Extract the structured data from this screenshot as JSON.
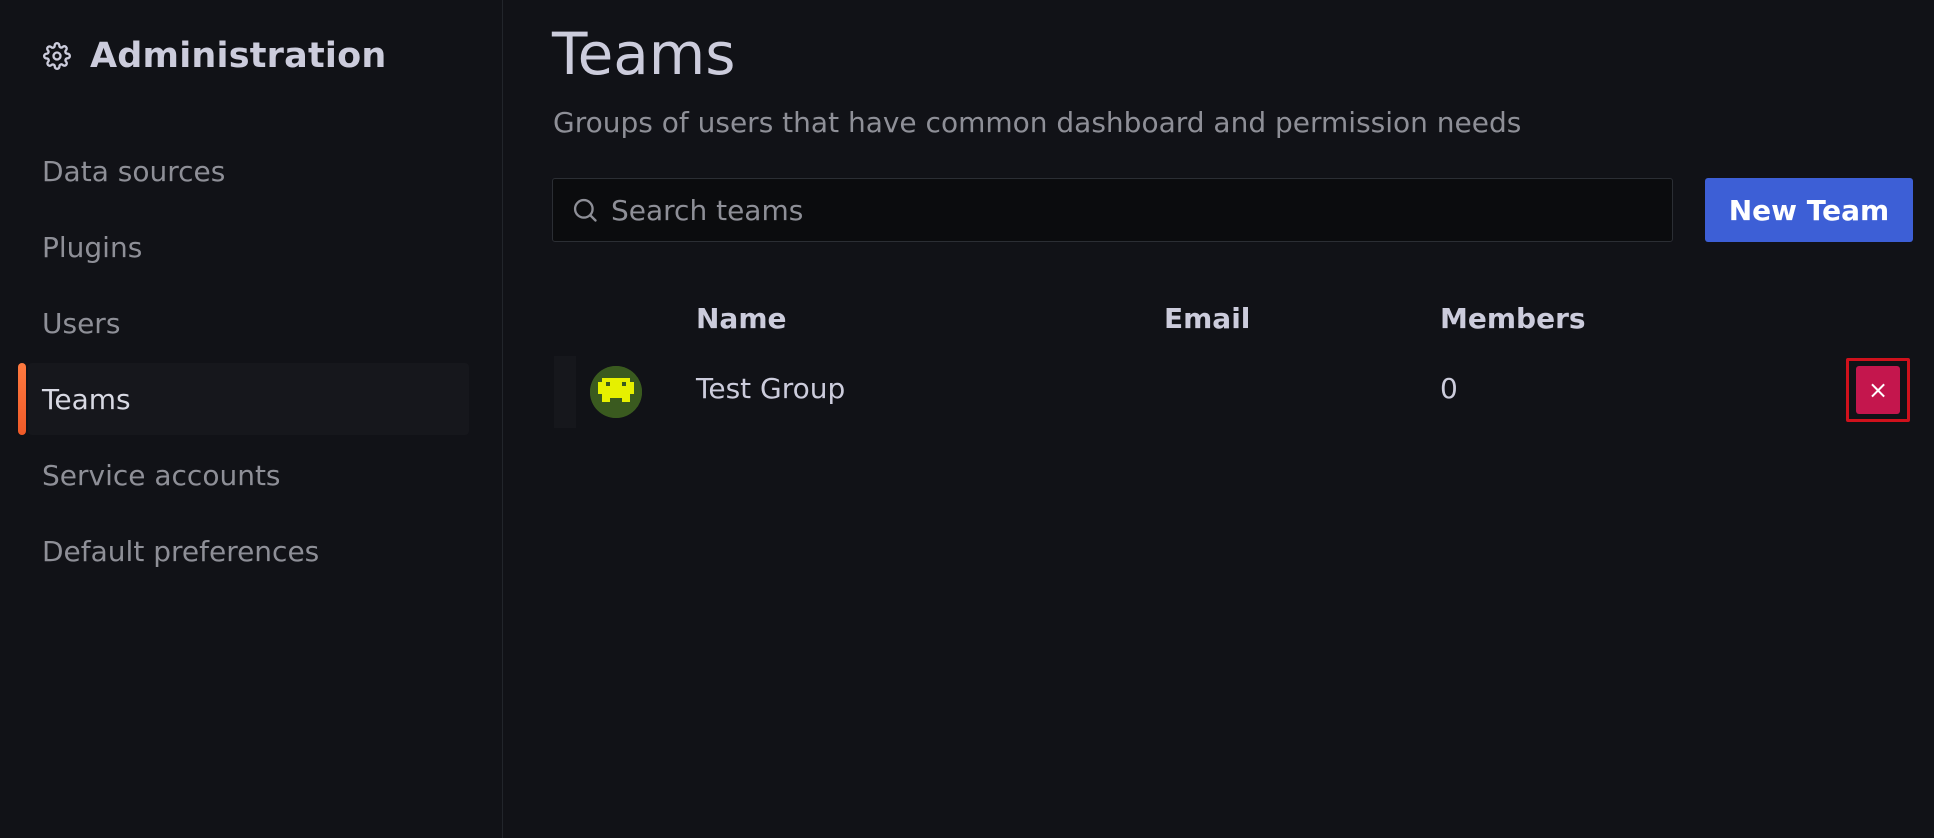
{
  "sidebar": {
    "title": "Administration",
    "header_icon": "gear-icon",
    "items": [
      {
        "label": "Data sources",
        "active": false
      },
      {
        "label": "Plugins",
        "active": false
      },
      {
        "label": "Users",
        "active": false
      },
      {
        "label": "Teams",
        "active": true
      },
      {
        "label": "Service accounts",
        "active": false
      },
      {
        "label": "Default preferences",
        "active": false
      }
    ],
    "active_indicator_color": "#f05a28"
  },
  "page": {
    "title": "Teams",
    "subtitle": "Groups of users that have common dashboard and permission needs"
  },
  "search": {
    "placeholder": "Search teams",
    "value": "",
    "icon": "search-icon"
  },
  "toolbar": {
    "new_team_label": "New Team",
    "new_team_color": "#3d5fd6"
  },
  "table": {
    "columns": [
      "Name",
      "Email",
      "Members"
    ],
    "rows": [
      {
        "avatar": "team-avatar",
        "name": "Test Group",
        "email": "",
        "members": "0",
        "delete_icon": "close-icon",
        "delete_label": "×",
        "delete_color": "#c4164d"
      }
    ]
  }
}
